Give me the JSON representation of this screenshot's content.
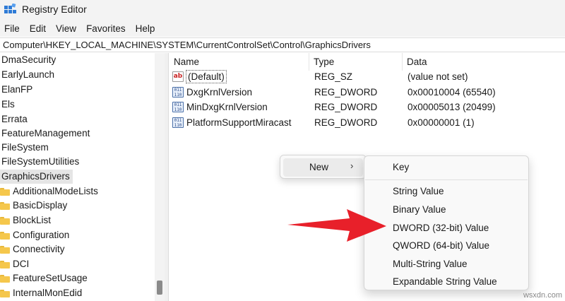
{
  "window": {
    "title": "Registry Editor"
  },
  "menu": [
    "File",
    "Edit",
    "View",
    "Favorites",
    "Help"
  ],
  "address": "Computer\\HKEY_LOCAL_MACHINE\\SYSTEM\\CurrentControlSet\\Control\\GraphicsDrivers",
  "tree": {
    "items": [
      {
        "label": "DmaSecurity"
      },
      {
        "label": "EarlyLaunch"
      },
      {
        "label": "ElanFP"
      },
      {
        "label": "Els"
      },
      {
        "label": "Errata"
      },
      {
        "label": "FeatureManagement"
      },
      {
        "label": "FileSystem"
      },
      {
        "label": "FileSystemUtilities"
      },
      {
        "label": "GraphicsDrivers"
      }
    ],
    "children": [
      {
        "label": "AdditionalModeLists"
      },
      {
        "label": "BasicDisplay"
      },
      {
        "label": "BlockList"
      },
      {
        "label": "Configuration"
      },
      {
        "label": "Connectivity"
      },
      {
        "label": "DCI"
      },
      {
        "label": "FeatureSetUsage"
      },
      {
        "label": "InternalMonEdid"
      }
    ]
  },
  "columns": {
    "name": "Name",
    "type": "Type",
    "data": "Data"
  },
  "values": [
    {
      "icon": "ab",
      "name": "(Default)",
      "type": "REG_SZ",
      "data": "(value not set)"
    },
    {
      "icon": "011\n110",
      "name": "DxgKrnlVersion",
      "type": "REG_DWORD",
      "data": "0x00010004 (65540)"
    },
    {
      "icon": "011\n110",
      "name": "MinDxgKrnlVersion",
      "type": "REG_DWORD",
      "data": "0x00005013 (20499)"
    },
    {
      "icon": "011\n110",
      "name": "PlatformSupportMiracast",
      "type": "REG_DWORD",
      "data": "0x00000001 (1)"
    }
  ],
  "context_menu": {
    "new_label": "New",
    "arrow": "›"
  },
  "submenu": {
    "items": [
      "Key",
      "String Value",
      "Binary Value",
      "DWORD (32-bit) Value",
      "QWORD (64-bit) Value",
      "Multi-String Value",
      "Expandable String Value"
    ]
  },
  "watermark": "wsxdn.com",
  "colors": {
    "arrow": "#e8202a",
    "selection": "#e5e5e5",
    "folder": "#f5c74c"
  }
}
